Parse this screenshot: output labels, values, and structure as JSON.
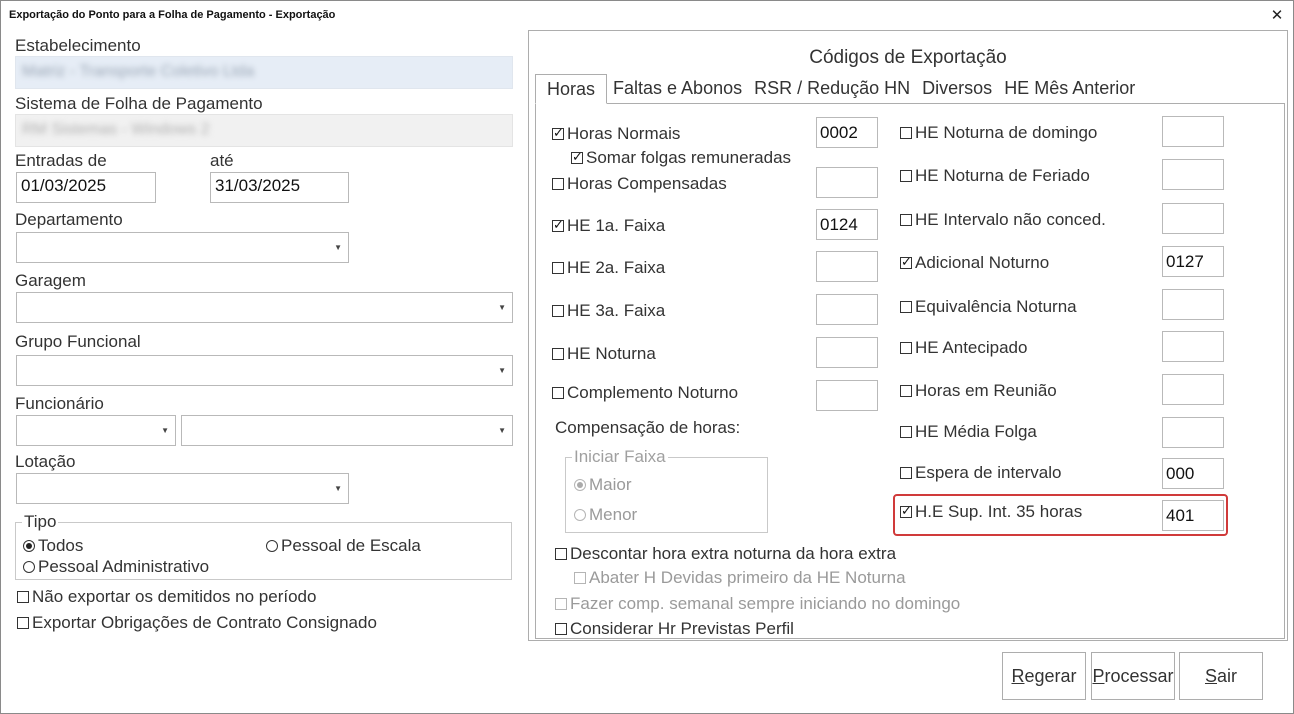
{
  "window": {
    "title": "Exportação do Ponto para a Folha de Pagamento - Exportação"
  },
  "left": {
    "estabelecimento_label": "Estabelecimento",
    "estabelecimento_value": "Matriz - Transporte Coletivo Ltda",
    "sistema_label": "Sistema de Folha de Pagamento",
    "sistema_value": "RM Sistemas - Windows 2",
    "entradas_label": "Entradas de",
    "ate_label": "até",
    "entradas_de": "01/03/2025",
    "entradas_ate": "31/03/2025",
    "departamento_label": "Departamento",
    "garagem_label": "Garagem",
    "grupo_label": "Grupo Funcional",
    "funcionario_label": "Funcionário",
    "lotacao_label": "Lotação",
    "tipo": {
      "title": "Tipo",
      "todos": "Todos",
      "escala": "Pessoal de Escala",
      "admin": "Pessoal Administrativo",
      "selected": "Todos"
    },
    "nao_exportar_demitidos": "Não exportar os demitidos no período",
    "exportar_consignado": "Exportar Obrigações de Contrato Consignado"
  },
  "panel": {
    "title": "Códigos de Exportação",
    "tabs": [
      "Horas",
      "Faltas e Abonos",
      "RSR / Redução HN",
      "Diversos",
      "HE Mês Anterior"
    ],
    "active_tab": "Horas",
    "left_items": [
      {
        "label": "Horas Normais",
        "checked": true,
        "code": "0002"
      },
      {
        "label": "Somar folgas remuneradas",
        "checked": true
      },
      {
        "label": "Horas Compensadas",
        "checked": false,
        "code": ""
      },
      {
        "label": "HE 1a. Faixa",
        "checked": true,
        "code": "0124"
      },
      {
        "label": "HE 2a. Faixa",
        "checked": false,
        "code": ""
      },
      {
        "label": "HE 3a. Faixa",
        "checked": false,
        "code": ""
      },
      {
        "label": "HE Noturna",
        "checked": false,
        "code": ""
      },
      {
        "label": "Complemento Noturno",
        "checked": false,
        "code": ""
      }
    ],
    "right_items": [
      {
        "label": "HE Noturna de domingo",
        "checked": false,
        "code": ""
      },
      {
        "label": "HE Noturna de Feriado",
        "checked": false,
        "code": ""
      },
      {
        "label": "HE Intervalo não conced.",
        "checked": false,
        "code": ""
      },
      {
        "label": "Adicional Noturno",
        "checked": true,
        "code": "0127"
      },
      {
        "label": "Equivalência Noturna",
        "checked": false,
        "code": ""
      },
      {
        "label": "HE Antecipado",
        "checked": false,
        "code": ""
      },
      {
        "label": "Horas em Reunião",
        "checked": false,
        "code": ""
      },
      {
        "label": "HE Média Folga",
        "checked": false,
        "code": ""
      },
      {
        "label": "Espera de intervalo",
        "checked": false,
        "code": "000"
      },
      {
        "label": "H.E Sup. Int. 35 horas",
        "checked": true,
        "code": "401"
      }
    ],
    "compensacao": {
      "label": "Compensação de horas:",
      "group_title": "Iniciar Faixa",
      "maior": "Maior",
      "menor": "Menor",
      "selected": "Maior"
    },
    "descontar": "Descontar hora extra noturna da hora extra",
    "abater": "Abater H Devidas primeiro da HE Noturna",
    "fazer_comp": "Fazer comp. semanal sempre iniciando no domingo",
    "considerar": "Considerar Hr Previstas Perfil"
  },
  "buttons": {
    "regerar_u": "R",
    "regerar_rest": "egerar",
    "processar_u": "P",
    "processar_rest": "rocessar",
    "sair_u": "S",
    "sair_rest": "air"
  }
}
